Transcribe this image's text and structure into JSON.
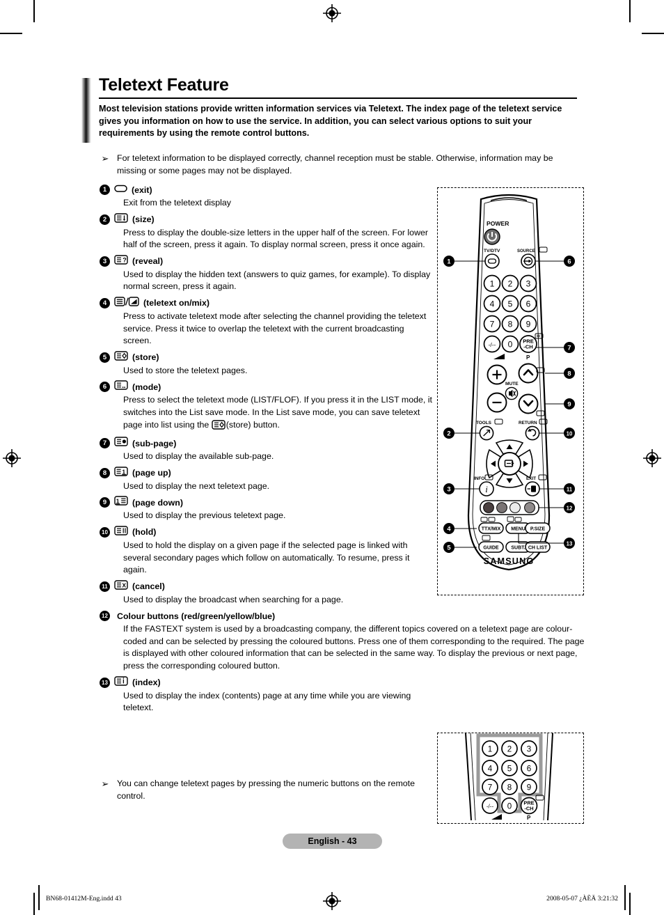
{
  "document": {
    "title": "Teletext Feature",
    "lead": "Most television stations provide written information services via Teletext. The index page of the teletext service gives you information on how to use the service. In addition, you can select various options to suit your requirements by using the remote control buttons.",
    "page_badge": "English - 43"
  },
  "notes": {
    "top": "For teletext information to be displayed correctly, channel reception must be stable. Otherwise, information may be missing or some pages may not be displayed.",
    "bottom": "You can change teletext pages by pressing the numeric buttons on the remote control.",
    "arrow_glyph": "➢"
  },
  "items": [
    {
      "number": "1",
      "icon": "exit-rounded-rect-icon",
      "label": "(exit)",
      "body": "Exit from the teletext display"
    },
    {
      "number": "2",
      "icon": "size-icon",
      "label": "(size)",
      "body": "Press to display the double-size letters in the upper half of the screen. For lower half of the screen, press it again. To display normal screen, press it once again."
    },
    {
      "number": "3",
      "icon": "reveal-icon",
      "label": "(reveal)",
      "body": "Used to display the hidden text (answers to quiz games, for example). To display normal screen, press it again."
    },
    {
      "number": "4",
      "icon": "teletext-on-mix-icon",
      "label": "(teletext on/mix)",
      "body": "Press to activate teletext mode after selecting the channel providing the teletext service. Press it twice to overlap the teletext with the current broadcasting screen."
    },
    {
      "number": "5",
      "icon": "store-icon",
      "label": "(store)",
      "body": "Used to store the teletext pages."
    },
    {
      "number": "6",
      "icon": "mode-icon",
      "label": "(mode)",
      "body_before": "Press to select the teletext mode (LIST/FLOF). If you press it in the LIST mode, it switches into the List save mode. In the List save mode, you can save teletext page into list using the ",
      "body_after": "(store) button.",
      "inline_icon": "store-icon"
    },
    {
      "number": "7",
      "icon": "sub-page-icon",
      "label": "(sub-page)",
      "body": "Used to display the available sub-page."
    },
    {
      "number": "8",
      "icon": "page-up-icon",
      "label": "(page up)",
      "body": "Used to display the next teletext page."
    },
    {
      "number": "9",
      "icon": "page-down-icon",
      "label": "(page down)",
      "body": "Used to display the previous teletext page."
    },
    {
      "number": "10",
      "icon": "hold-icon",
      "label": "(hold)",
      "body": "Used to hold the display on a given page if the selected page is linked with several secondary pages which follow on automatically. To resume, press it again."
    },
    {
      "number": "11",
      "icon": "cancel-icon",
      "label": "(cancel)",
      "body": "Used to display the broadcast when searching for a page."
    },
    {
      "number": "12",
      "icon": "",
      "label": "Colour buttons (red/green/yellow/blue)",
      "body": "If the FASTEXT system is used by a broadcasting company, the different topics covered on a teletext page are colour-coded and can be selected by pressing the coloured buttons. Press one of them corresponding to the required. The page is displayed with other coloured information that can be selected in the same way. To display the previous or next page, press the corresponding coloured button."
    },
    {
      "number": "13",
      "icon": "index-icon",
      "label": "(index)",
      "body": "Used to display the index (contents) page at any time while you are viewing teletext."
    }
  ],
  "remote": {
    "brand": "SAMSUNG",
    "power_label": "POWER",
    "tvdtv_label": "TV/DTV",
    "source_label": "SOURCE",
    "mute_label": "MUTE",
    "tools_label": "TOOLS",
    "return_label": "RETURN",
    "info_label": "INFO",
    "exit_label": "EXIT",
    "p_label": "P",
    "prech_top": "PRE",
    "prech_bottom": "-CH",
    "dash_key": "-/--",
    "zero_key": "0",
    "numbers": [
      "1",
      "2",
      "3",
      "4",
      "5",
      "6",
      "7",
      "8",
      "9"
    ],
    "buttons_row1": [
      "TTX/MIX",
      "MENU",
      "P.SIZE"
    ],
    "buttons_row2": [
      "GUIDE",
      "SUBT.",
      "CH LIST"
    ],
    "callouts_left": [
      "1",
      "2",
      "3",
      "4",
      "5"
    ],
    "callouts_right": [
      "6",
      "7",
      "8",
      "9",
      "10",
      "11",
      "12",
      "13"
    ],
    "colour_buttons": [
      "#4a4040",
      "#7a7474",
      "#ebebeb",
      "#8f8a8a"
    ],
    "plus_key": "+",
    "minus_key": "−"
  },
  "remote_mini": {
    "numbers": [
      "1",
      "2",
      "3",
      "4",
      "5",
      "6",
      "7",
      "8",
      "9"
    ],
    "dash_key": "-/--",
    "zero_key": "0",
    "prech_top": "PRE",
    "prech_bottom": "-CH",
    "p_label": "P"
  },
  "footer": {
    "left": "BN68-01412M-Eng.indd   43",
    "right": "2008-05-07   ¿ÀÈÄ 3:21:32"
  }
}
